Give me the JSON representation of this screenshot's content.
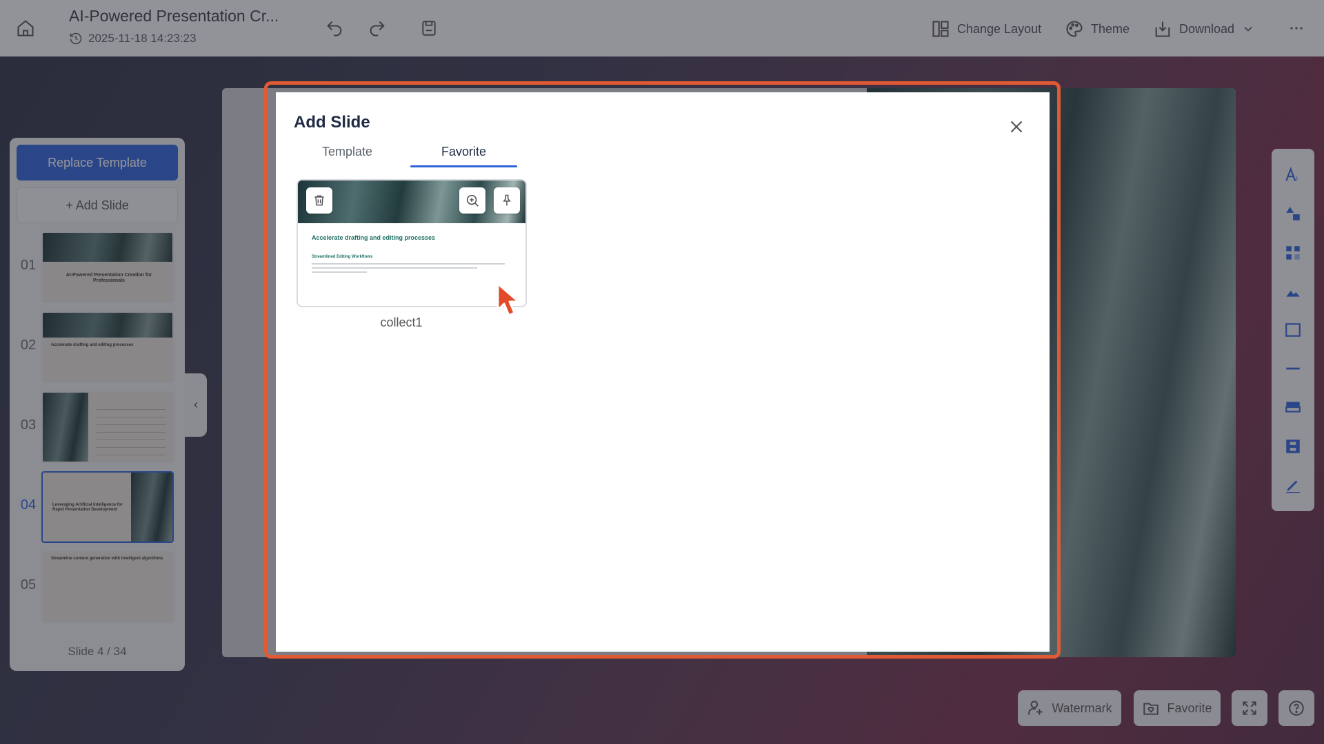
{
  "header": {
    "title": "AI-Powered Presentation Cr...",
    "timestamp": "2025-11-18 14:23:23",
    "change_layout": "Change Layout",
    "theme": "Theme",
    "download": "Download"
  },
  "sidebar": {
    "replace_template": "Replace Template",
    "add_slide": "+ Add Slide",
    "slides": [
      {
        "num": "01",
        "title": "AI-Powered Presentation Creation for Professionals"
      },
      {
        "num": "02",
        "title": "Accelerate drafting and editing processes"
      },
      {
        "num": "03",
        "title": ""
      },
      {
        "num": "04",
        "title": "Leveraging Artificial Intelligence for Rapid Presentation Development"
      },
      {
        "num": "05",
        "title": "Streamline content generation with intelligent algorithms"
      }
    ],
    "slide_counter": "Slide 4 / 34"
  },
  "bottom": {
    "watermark": "Watermark",
    "favorite": "Favorite"
  },
  "modal": {
    "title": "Add Slide",
    "tabs": [
      "Template",
      "Favorite"
    ],
    "active_tab": "Favorite",
    "items": [
      {
        "label": "collect1",
        "heading": "Accelerate drafting and editing processes",
        "subheading": "Streamlined Editing Workflows"
      }
    ]
  },
  "colors": {
    "accent": "#2f62d8",
    "highlight": "#e25a33"
  }
}
